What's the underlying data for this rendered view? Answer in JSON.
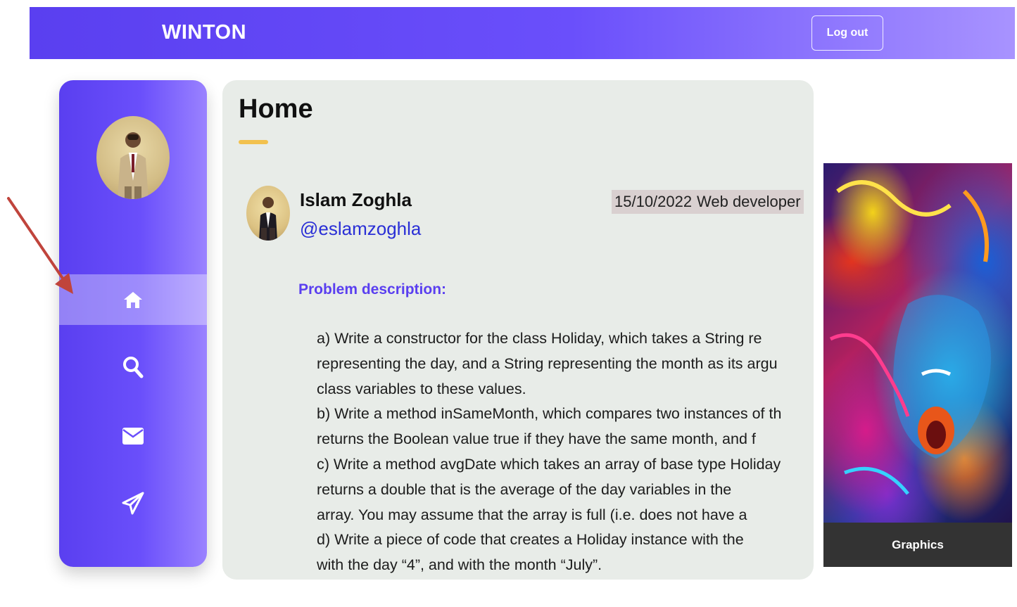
{
  "header": {
    "brand": "WINTON",
    "logout_label": "Log out"
  },
  "sidebar": {
    "items": [
      {
        "name": "home",
        "icon": "home-icon",
        "active": true
      },
      {
        "name": "search",
        "icon": "search-icon",
        "active": false
      },
      {
        "name": "mail",
        "icon": "envelope-icon",
        "active": false
      },
      {
        "name": "send",
        "icon": "paper-plane-icon",
        "active": false
      }
    ]
  },
  "main": {
    "title": "Home",
    "post": {
      "author_name": "Islam Zoghla",
      "author_handle": "@eslamzoghla",
      "date": "15/10/2022",
      "role": "Web developer",
      "problem_title": "Problem description:",
      "problem_lines": [
        "a) Write a constructor for the class Holiday, which takes a String re",
        "representing the day, and a String representing the month as its argu",
        "class variables to these values.",
        "b) Write a method inSameMonth, which compares two instances of th",
        "returns the Boolean value true if they have the same month, and f",
        "c) Write a method avgDate which takes an array of base type Holiday",
        "returns a double that is the average of the day variables in the",
        "array. You may assume that the array is full (i.e. does not have a",
        "d) Write a piece of code that creates a Holiday instance with the",
        "with the day “4”, and with the month “July”."
      ]
    }
  },
  "aside": {
    "caption": "Graphics"
  },
  "colors": {
    "brand_purple": "#5a3ff0",
    "accent_yellow": "#f2c14e",
    "handle_blue": "#2a2fd6",
    "arrow_red": "#c0443c"
  }
}
